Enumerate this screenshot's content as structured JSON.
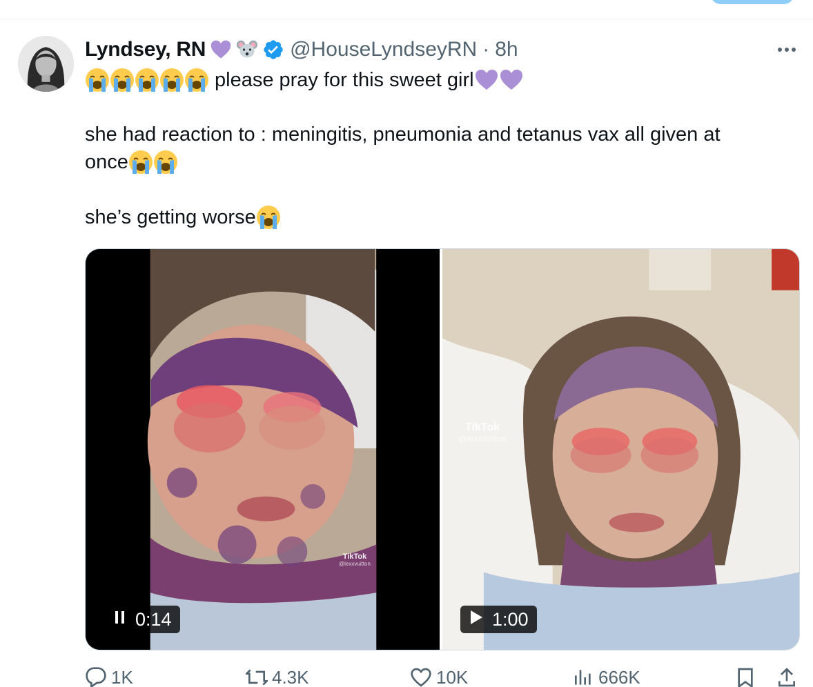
{
  "tweet": {
    "display_name": "Lyndsey, RN",
    "handle": "@HouseLyndseyRN",
    "separator": "·",
    "time": "8h",
    "line1_text": "please pray for this sweet girl",
    "line2_text": "she had reaction to : meningitis, pneumonia and tetanus vax all given at",
    "line3_text": "once",
    "line4_text": "she’s getting worse",
    "header_icons": [
      "purple-heart-icon",
      "mouse-face-icon",
      "verified-badge-icon"
    ],
    "text_icons": [
      "crying-face-icon",
      "purple-heart-icon"
    ]
  },
  "media": {
    "left_video": {
      "state": "playing",
      "duration": "0:14",
      "watermark_name": "TikTok",
      "watermark_user": "@lexxvuitton"
    },
    "right_video": {
      "state": "paused",
      "duration": "1:00",
      "watermark_name": "TikTok",
      "watermark_user": "@lexxvuitton"
    }
  },
  "actions": {
    "replies": "1K",
    "reposts": "4.3K",
    "likes": "10K",
    "views": "666K"
  },
  "colors": {
    "accent_blue": "#1d9bf0",
    "secondary_text": "#536471",
    "heart_purple": "#aa8ed6"
  }
}
